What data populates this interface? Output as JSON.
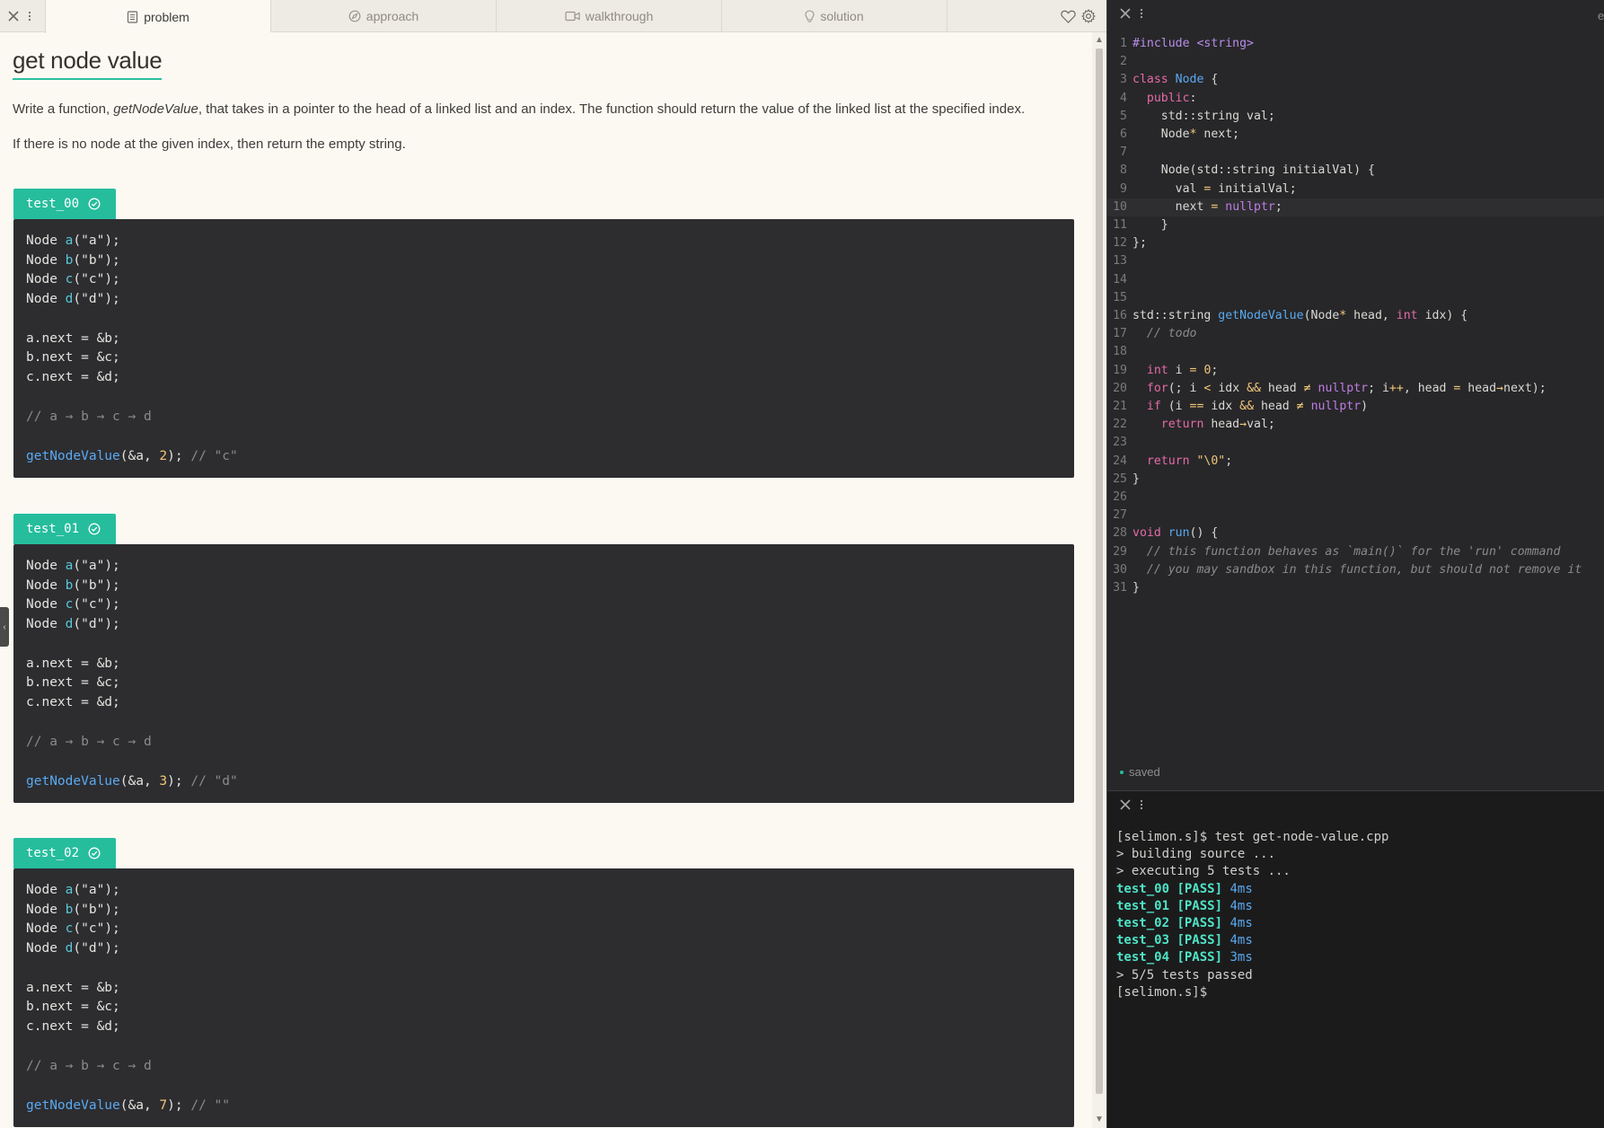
{
  "colors": {
    "accent": "#26bd9d",
    "editor_bg": "#272729",
    "terminal_bg": "#1b1b1c",
    "page_bg": "#fcf9f3"
  },
  "tabs": [
    {
      "label": "problem",
      "icon": "document-icon"
    },
    {
      "label": "approach",
      "icon": "compass-icon"
    },
    {
      "label": "walkthrough",
      "icon": "video-icon"
    },
    {
      "label": "solution",
      "icon": "lightbulb-icon"
    }
  ],
  "problem": {
    "title": "get node value",
    "description_before": "Write a function, ",
    "description_fn": "getNodeValue",
    "description_after": ", that takes in a pointer to the head of a linked list and an index. The function should return the value of the linked list at the specified index.",
    "note": "If there is no node at the given index, then return the empty string."
  },
  "tests": [
    {
      "name": "test_00",
      "setup": [
        "Node a(\"a\");",
        "Node b(\"b\");",
        "Node c(\"c\");",
        "Node d(\"d\");"
      ],
      "links": [
        "a.next = &b;",
        "b.next = &c;",
        "c.next = &d;"
      ],
      "diagram": "// a → b → c → d",
      "call": "getNodeValue(&a, 2);",
      "call_comment": "// \"c\""
    },
    {
      "name": "test_01",
      "setup": [
        "Node a(\"a\");",
        "Node b(\"b\");",
        "Node c(\"c\");",
        "Node d(\"d\");"
      ],
      "links": [
        "a.next = &b;",
        "b.next = &c;",
        "c.next = &d;"
      ],
      "diagram": "// a → b → c → d",
      "call": "getNodeValue(&a, 3);",
      "call_comment": "// \"d\""
    },
    {
      "name": "test_02",
      "setup": [
        "Node a(\"a\");",
        "Node b(\"b\");",
        "Node c(\"c\");",
        "Node d(\"d\");"
      ],
      "links": [
        "a.next = &b;",
        "b.next = &c;",
        "c.next = &d;"
      ],
      "diagram": "// a → b → c → d",
      "call": "getNodeValue(&a, 7);",
      "call_comment": "// \"\""
    }
  ],
  "editor": {
    "top_right_text": "e",
    "lines": [
      "#include <string>",
      "",
      "class Node {",
      "  public:",
      "    std::string val;",
      "    Node* next;",
      "",
      "    Node(std::string initialVal) {",
      "      val = initialVal;",
      "      next = nullptr;",
      "    }",
      "};",
      "",
      "",
      "",
      "std::string getNodeValue(Node* head, int idx) {",
      "  // todo",
      "",
      "  int i = 0;",
      "  for(; i < idx && head != nullptr; i++, head = head->next);",
      "  if (i == idx && head != nullptr)",
      "    return head->val;",
      "",
      "  return \"\\0\";",
      "}",
      "",
      "",
      "void run() {",
      "  // this function behaves as `main()` for the 'run' command",
      "  // you may sandbox in this function, but should not remove it",
      "}"
    ],
    "current_line": 10,
    "status": "saved"
  },
  "terminal": {
    "prompt_command": "[selimon.s]$ test get-node-value.cpp",
    "building": "> building source ...",
    "executing": "> executing 5 tests ...",
    "results": [
      {
        "name": "test_00",
        "status": "[PASS]",
        "time": "4ms"
      },
      {
        "name": "test_01",
        "status": "[PASS]",
        "time": "4ms"
      },
      {
        "name": "test_02",
        "status": "[PASS]",
        "time": "4ms"
      },
      {
        "name": "test_03",
        "status": "[PASS]",
        "time": "4ms"
      },
      {
        "name": "test_04",
        "status": "[PASS]",
        "time": "3ms"
      }
    ],
    "summary": "> 5/5 tests passed",
    "final_prompt": "[selimon.s]$"
  }
}
